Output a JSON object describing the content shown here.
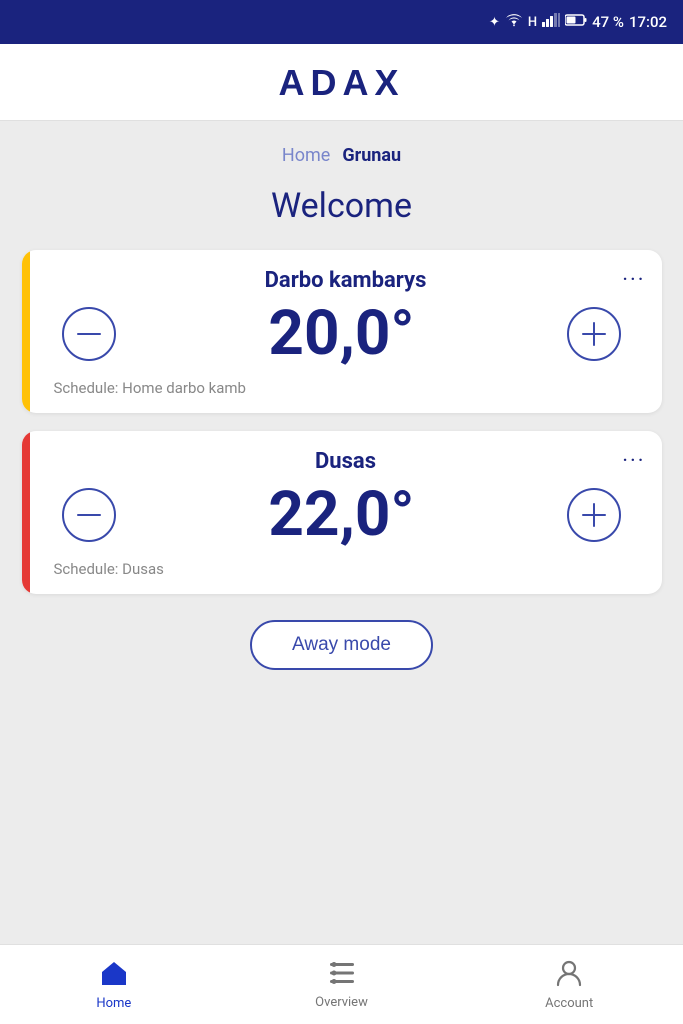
{
  "status_bar": {
    "battery": "47 %",
    "time": "17:02"
  },
  "header": {
    "logo": "ADAX"
  },
  "breadcrumb": {
    "home_label": "Home",
    "current_label": "Grunau"
  },
  "welcome": {
    "title": "Welcome"
  },
  "devices": [
    {
      "id": "darbo",
      "name": "Darbo kambarys",
      "temperature": "20,0°",
      "schedule": "Schedule: Home darbo kamb",
      "accent_color": "yellow",
      "menu_label": "···"
    },
    {
      "id": "dusas",
      "name": "Dusas",
      "temperature": "22,0°",
      "schedule": "Schedule: Dusas",
      "accent_color": "orange",
      "menu_label": "···"
    }
  ],
  "away_mode_button": {
    "label": "Away mode"
  },
  "bottom_nav": {
    "items": [
      {
        "id": "home",
        "label": "Home",
        "active": true
      },
      {
        "id": "overview",
        "label": "Overview",
        "active": false
      },
      {
        "id": "account",
        "label": "Account",
        "active": false
      }
    ]
  }
}
